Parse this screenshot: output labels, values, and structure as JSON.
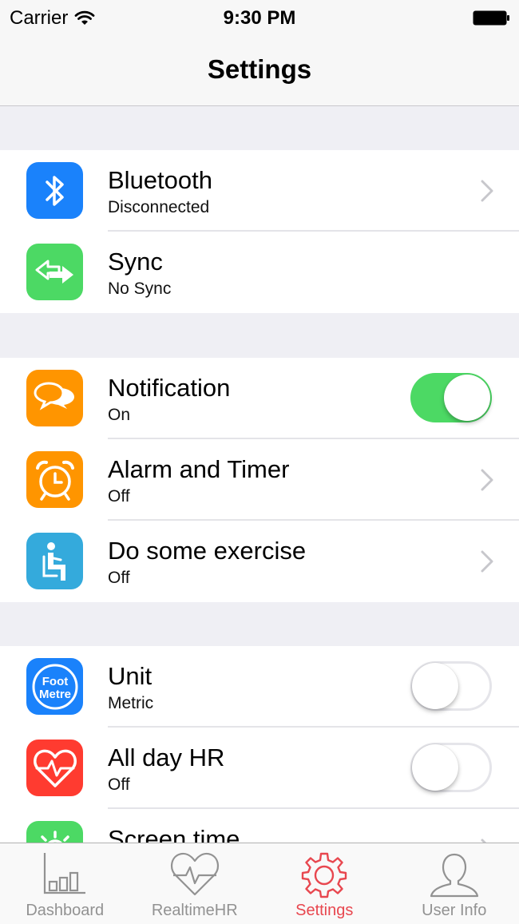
{
  "status": {
    "carrier": "Carrier",
    "time": "9:30 PM"
  },
  "nav": {
    "title": "Settings"
  },
  "sections": [
    {
      "rows": [
        {
          "title": "Bluetooth",
          "subtitle": "Disconnected",
          "icon": "bluetooth-icon",
          "color": "#1a82fb",
          "accessory": "chevron"
        },
        {
          "title": "Sync",
          "subtitle": "No Sync",
          "icon": "sync-arrows-icon",
          "color": "#4cd964",
          "accessory": "none"
        }
      ]
    },
    {
      "rows": [
        {
          "title": "Notification",
          "subtitle": "On",
          "icon": "chat-bubbles-icon",
          "color": "#ff9500",
          "accessory": "toggle",
          "toggle_on": true
        },
        {
          "title": "Alarm and Timer",
          "subtitle": "Off",
          "icon": "alarm-clock-icon",
          "color": "#ff9500",
          "accessory": "chevron"
        },
        {
          "title": "Do some exercise",
          "subtitle": "Off",
          "icon": "sitting-person-icon",
          "color": "#34aadc",
          "accessory": "chevron"
        }
      ]
    },
    {
      "rows": [
        {
          "title": "Unit",
          "subtitle": "Metric",
          "icon": "foot-metre-icon",
          "icon_text": [
            "Foot",
            "Metre"
          ],
          "color": "#1a82fb",
          "accessory": "toggle",
          "toggle_on": false
        },
        {
          "title": "All day HR",
          "subtitle": "Off",
          "icon": "heart-rate-icon",
          "color": "#ff3b30",
          "accessory": "toggle",
          "toggle_on": false
        },
        {
          "title": "Screen time",
          "subtitle": "",
          "icon": "sun-icon",
          "color": "#4cd964",
          "accessory": "chevron"
        }
      ]
    }
  ],
  "tabbar": {
    "tabs": [
      {
        "label": "Dashboard",
        "icon": "bar-chart-icon"
      },
      {
        "label": "RealtimeHR",
        "icon": "heart-pulse-icon"
      },
      {
        "label": "Settings",
        "icon": "gear-icon",
        "active": true
      },
      {
        "label": "User Info",
        "icon": "user-icon"
      }
    ],
    "active_color": "#e8474f",
    "inactive_color": "#929292"
  }
}
